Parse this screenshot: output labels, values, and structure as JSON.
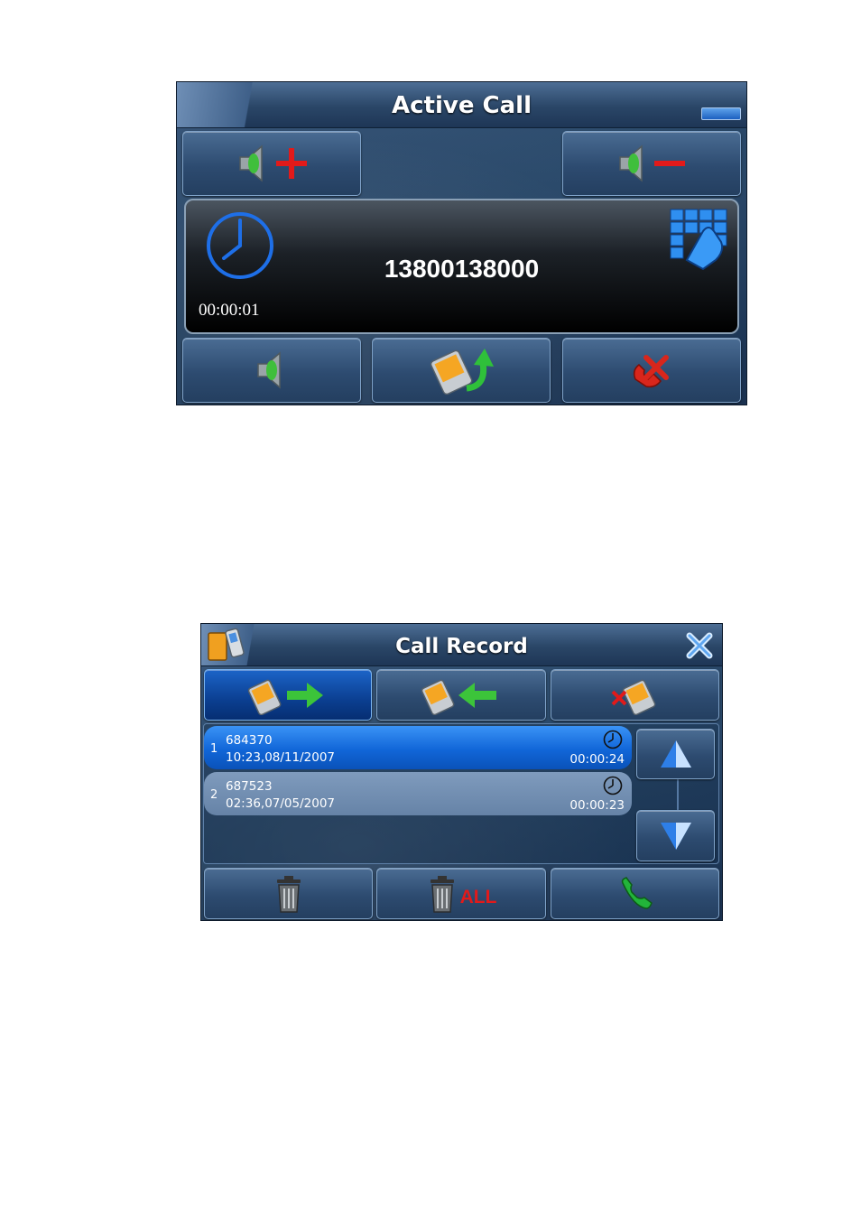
{
  "active_call": {
    "title": "Active Call",
    "phone_number": "13800138000",
    "elapsed": "00:00:01"
  },
  "call_record": {
    "title": "Call Record",
    "records": [
      {
        "index": "1",
        "number": "684370",
        "datetime": "10:23,08/11/2007",
        "duration": "00:00:24",
        "selected": true
      },
      {
        "index": "2",
        "number": "687523",
        "datetime": "02:36,07/05/2007",
        "duration": "00:00:23",
        "selected": false
      }
    ],
    "delete_all_label": "ALL"
  },
  "colors": {
    "accent_blue": "#1a6fe0",
    "plus_red": "#e21a1a",
    "hangup_red": "#d8261c",
    "call_green": "#22b43a"
  }
}
